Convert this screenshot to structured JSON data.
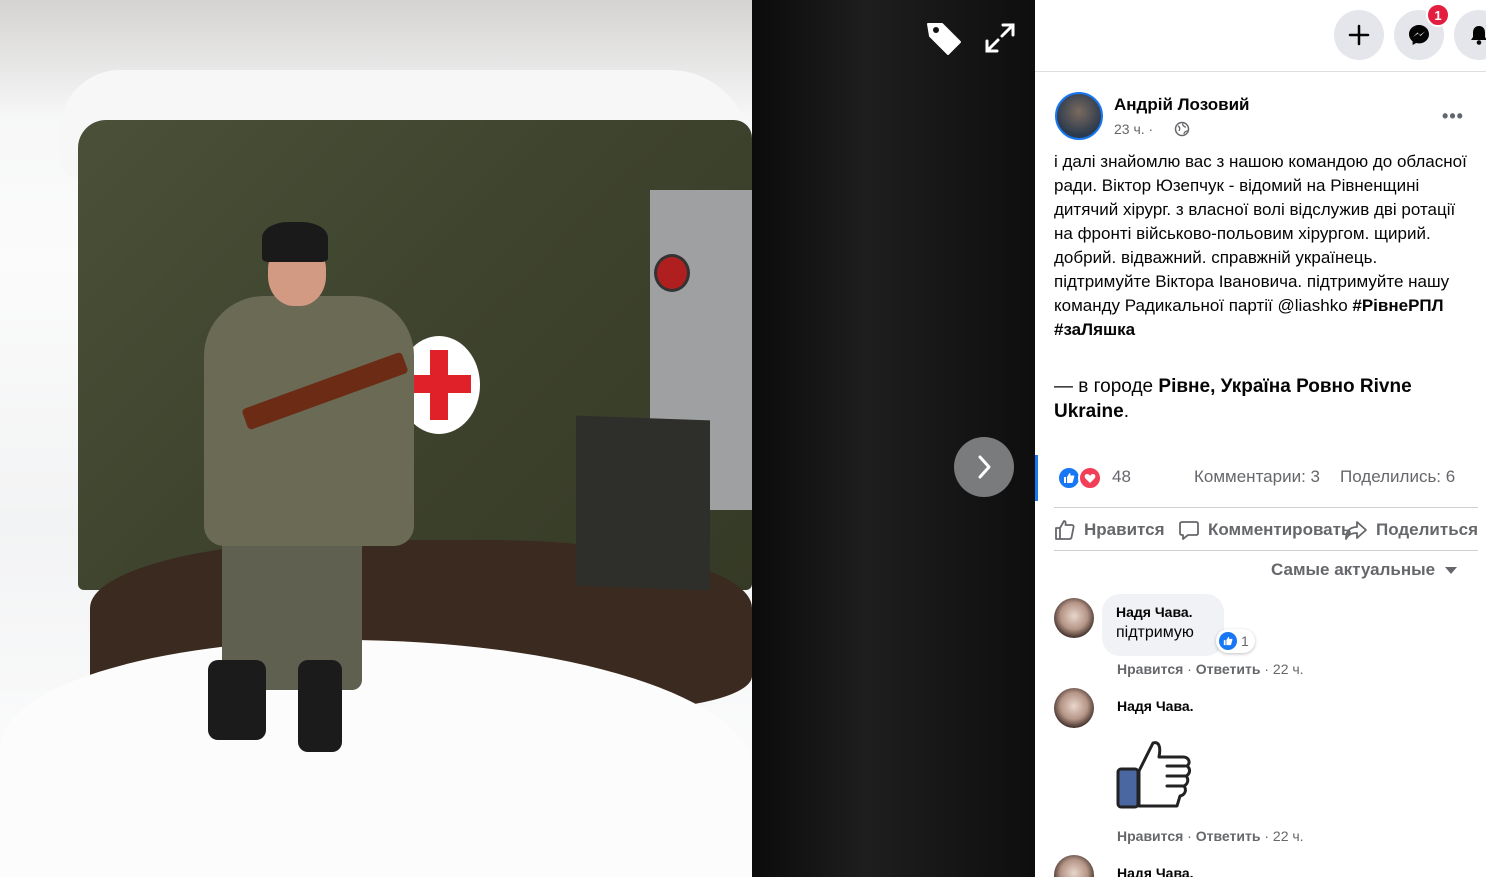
{
  "viewer": {
    "tag_icon": "tag-icon",
    "expand_icon": "expand-icon",
    "next_icon": "chevron-right-icon"
  },
  "topbar": {
    "create_icon": "plus-icon",
    "messenger_icon": "messenger-icon",
    "messenger_badge": "1",
    "notifications_icon": "bell-icon"
  },
  "post": {
    "author": "Андрій Лозовий",
    "time": "23 ч. ·",
    "text": "і далі знайомлю вас з нашою командою до обласної ради. Віктор Юзепчук - відомий на Рівненщині дитячий хірург. з власної волі відслужив дві ротації на фронті військово-польовим хірургом. щирий. добрий. відважний. справжній українець. підтримуйте Віктора Івановича. підтримуйте нашу команду Радикальної партії @liashko ",
    "hashtag1": "#РівнеРПЛ",
    "hashtag2": "#заЛяшка",
    "location_prefix": "— в городе ",
    "location_place": "Рівне, Україна Ровно Rivne Ukraine",
    "location_suffix": "."
  },
  "stats": {
    "reactions": "48",
    "comments": "Комментарии: 3",
    "shares": "Поделились: 6"
  },
  "actions": {
    "like": "Нравится",
    "comment": "Комментировать",
    "share": "Поделиться"
  },
  "sort": {
    "label": "Самые актуальные"
  },
  "comments": [
    {
      "name": "Надя Чава.",
      "text": "підтримую",
      "reaction_count": "1",
      "like": "Нравится",
      "reply": "Ответить",
      "time": "22 ч."
    },
    {
      "name": "Надя Чава.",
      "sticker": "thumbs-up-sticker",
      "like": "Нравится",
      "reply": "Ответить",
      "time": "22 ч."
    },
    {
      "name": "Надя Чава."
    }
  ],
  "colors": {
    "accent": "#1877f2",
    "love": "#f33e58",
    "badge": "#e41e3f",
    "secondary_text": "#65676b"
  }
}
